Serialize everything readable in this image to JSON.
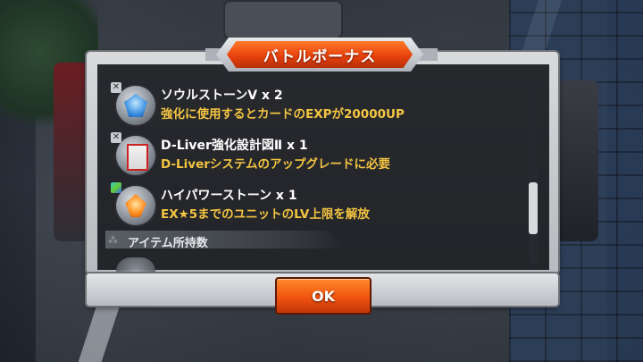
{
  "dialog": {
    "title": "バトルボーナス",
    "ok_label": "OK"
  },
  "rewards": [
    {
      "name": "ソウルストーンⅤ x 2",
      "description": "強化に使用するとカードのEXPが20000UP",
      "icon": "blue-crystal-icon"
    },
    {
      "name": "D-Liver強化設計図Ⅱ x 1",
      "description": "D-Liverシステムのアップグレードに必要",
      "icon": "blueprint-icon"
    },
    {
      "name": "ハイパワーストーン x 1",
      "description": "EX★5までのユニットのLV上限を解放",
      "icon": "orange-crystal-icon"
    }
  ],
  "section": {
    "label": "アイテム所持数"
  },
  "colors": {
    "accent": "#f0530e",
    "description_text": "#f4c542"
  }
}
